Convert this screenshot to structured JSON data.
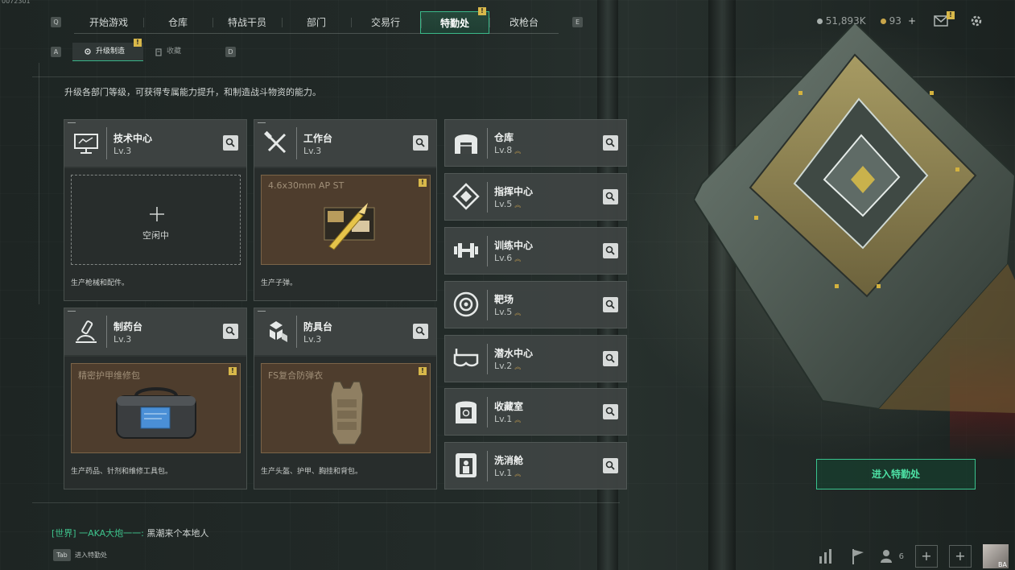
{
  "top_left_code": "0072301",
  "nav": {
    "left_key": "Q",
    "right_key": "E",
    "tabs": [
      {
        "label": "开始游戏"
      },
      {
        "label": "仓库"
      },
      {
        "label": "特战干员"
      },
      {
        "label": "部门"
      },
      {
        "label": "交易行"
      },
      {
        "label": "特勤处",
        "active": true,
        "badge": "!"
      },
      {
        "label": "改枪台"
      }
    ]
  },
  "subnav": {
    "left_key": "A",
    "right_key": "D",
    "tabs": [
      {
        "label": "升级制造",
        "active": true,
        "badge": "!"
      },
      {
        "label": "收藏"
      }
    ]
  },
  "currency": {
    "coins": "51,893K",
    "gems": "93",
    "add": "+"
  },
  "mail_badge": "!",
  "description": "升级各部门等级，可获得专属能力提升，和制造战斗物资的能力。",
  "facilities": [
    {
      "title": "技术中心",
      "level": "Lv.3",
      "icon": "tech-center-icon",
      "slot": {
        "state": "idle",
        "label": "空闲中"
      },
      "footer": "生产枪械和配件。"
    },
    {
      "title": "工作台",
      "level": "Lv.3",
      "icon": "workbench-icon",
      "slot": {
        "state": "producing",
        "item": "4.6x30mm AP ST",
        "item_image": "ammo-image",
        "badge": "!"
      },
      "footer": "生产子弹。"
    },
    {
      "title": "制药台",
      "level": "Lv.3",
      "icon": "pharmacy-icon",
      "slot": {
        "state": "producing",
        "item": "精密护甲维修包",
        "item_image": "repair-kit-image",
        "badge": "!"
      },
      "footer": "生产药品、针剂和维修工具包。"
    },
    {
      "title": "防具台",
      "level": "Lv.3",
      "icon": "armor-bench-icon",
      "slot": {
        "state": "producing",
        "item": "FS复合防弹衣",
        "item_image": "body-armor-image",
        "badge": "!"
      },
      "footer": "生产头盔、护甲、胸挂和背包。"
    }
  ],
  "departments": [
    {
      "title": "仓库",
      "level": "Lv.8",
      "icon": "warehouse-icon"
    },
    {
      "title": "指挥中心",
      "level": "Lv.5",
      "icon": "command-center-icon"
    },
    {
      "title": "训练中心",
      "level": "Lv.6",
      "icon": "training-center-icon"
    },
    {
      "title": "靶场",
      "level": "Lv.5",
      "icon": "shooting-range-icon"
    },
    {
      "title": "潜水中心",
      "level": "Lv.2",
      "icon": "diving-center-icon"
    },
    {
      "title": "收藏室",
      "level": "Lv.1",
      "icon": "collection-room-icon"
    },
    {
      "title": "洗消舱",
      "level": "Lv.1",
      "icon": "decontamination-icon"
    }
  ],
  "enter_button": "进入特勤处",
  "chat": {
    "channel": "[世界]",
    "name": "一AKA大炮一一:",
    "message": "黑潮来个本地人"
  },
  "tab_hint": {
    "key": "Tab",
    "label": "进入特勤处"
  },
  "bottom_bar": {
    "friends_count": "6",
    "avatar_text": "BA",
    "add_label": "+"
  },
  "colors": {
    "accent_green": "#39c48e",
    "badge_yellow": "#d8b84a",
    "slot_brown": "#4e3d2d"
  }
}
